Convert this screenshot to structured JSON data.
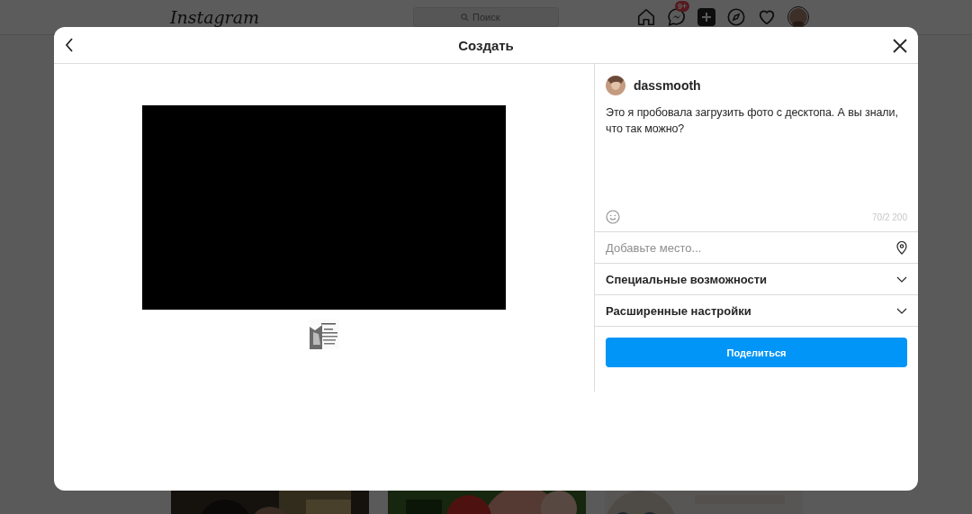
{
  "topbar": {
    "logo": "Instagram",
    "search": {
      "placeholder": "Поиск"
    },
    "messages_badge": "9+"
  },
  "dialog": {
    "title": "Создать",
    "thumbnails": [
      {
        "selected": true
      }
    ],
    "author": "dassmooth",
    "caption": "Это я пробовала загрузить фото с десктопа. А вы знали, что так можно?",
    "counter": "70/2 200",
    "location": {
      "placeholder": "Добавьте место..."
    },
    "sections": [
      {
        "label": "Специальные возможности",
        "expanded": false
      },
      {
        "label": "Расширенные настройки",
        "expanded": false
      }
    ],
    "share_button": "Поделиться"
  }
}
